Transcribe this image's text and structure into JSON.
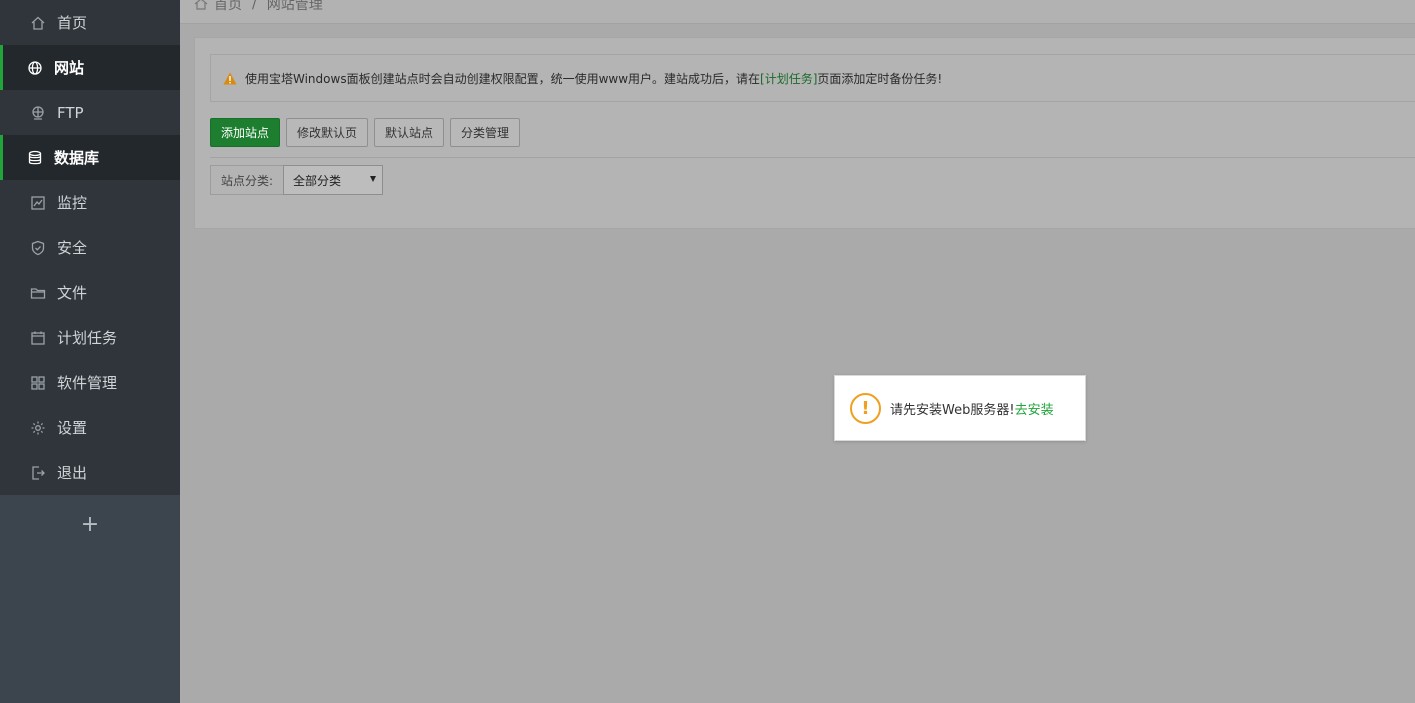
{
  "breadcrumb": {
    "home": "首页",
    "separator": "/",
    "current": "网站管理"
  },
  "sidebar": {
    "items": [
      {
        "label": "首页",
        "icon": "home-icon",
        "active": false
      },
      {
        "label": "网站",
        "icon": "globe-icon",
        "active": true
      },
      {
        "label": "FTP",
        "icon": "ftp-icon",
        "active": false
      },
      {
        "label": "数据库",
        "icon": "database-icon",
        "active": true
      },
      {
        "label": "监控",
        "icon": "monitor-chart-icon",
        "active": false
      },
      {
        "label": "安全",
        "icon": "shield-icon",
        "active": false
      },
      {
        "label": "文件",
        "icon": "folder-icon",
        "active": false
      },
      {
        "label": "计划任务",
        "icon": "calendar-icon",
        "active": false
      },
      {
        "label": "软件管理",
        "icon": "apps-grid-icon",
        "active": false
      },
      {
        "label": "设置",
        "icon": "gear-icon",
        "active": false
      },
      {
        "label": "退出",
        "icon": "logout-icon",
        "active": false
      }
    ],
    "add_label": "+"
  },
  "alert": {
    "text_before": "使用宝塔Windows面板创建站点时会自动创建权限配置，统一使用www用户。建站成功后，请在",
    "link": "[计划任务]",
    "text_after": "页面添加定时备份任务!"
  },
  "toolbar": {
    "add_site": "添加站点",
    "edit_default_page": "修改默认页",
    "default_site": "默认站点",
    "category_manage": "分类管理"
  },
  "filter": {
    "label": "站点分类:",
    "selected": "全部分类"
  },
  "popup": {
    "message": "请先安装Web服务器!",
    "action": "去安装"
  },
  "colors": {
    "accent": "#20a53a",
    "sidebar_bg": "#3c444d",
    "warning": "#f0a020"
  }
}
